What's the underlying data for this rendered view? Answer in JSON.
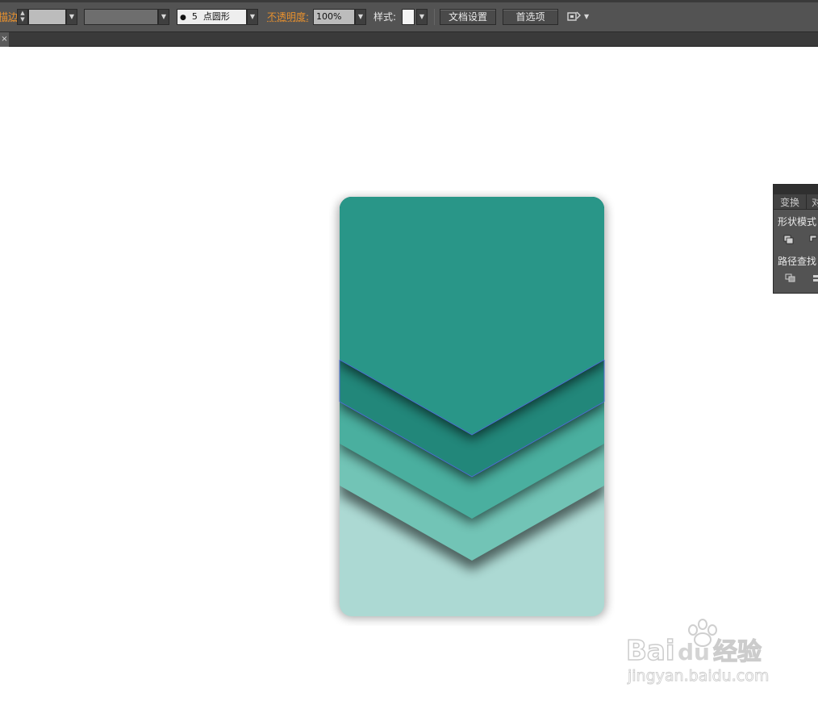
{
  "toolbar": {
    "stroke_label": "描边:",
    "stroke_value": "",
    "variable_profile": "",
    "brush": {
      "dot": "●",
      "size": "5",
      "shape": "点圆形"
    },
    "opacity_label": "不透明度:",
    "opacity_value": "100%",
    "style_label": "样式:",
    "doc_setup_label": "文档设置",
    "prefs_label": "首选项",
    "dropdown_arrow": "▼",
    "spinner_up": "▲",
    "spinner_down": "▼"
  },
  "tabbar": {
    "close_glyph": "×"
  },
  "panel": {
    "tab_transform": "变换",
    "tab_align": "对",
    "shape_modes": "形状模式",
    "pathfinder": "路径查找"
  },
  "artwork": {
    "colors": {
      "top": "#299688",
      "band1": "#22877a",
      "band2": "#4aaf9f",
      "band3": "#72c4b6",
      "bottom": "#acd9d3",
      "selection": "#4f6bd8"
    }
  },
  "watermark": {
    "brand_left": "Bai",
    "brand_right": "du",
    "brand_cn": "经验",
    "url": "jingyan.baidu.com"
  },
  "colors": {
    "toolbar_bg": "#535353",
    "accent_orange": "#e8912e"
  }
}
